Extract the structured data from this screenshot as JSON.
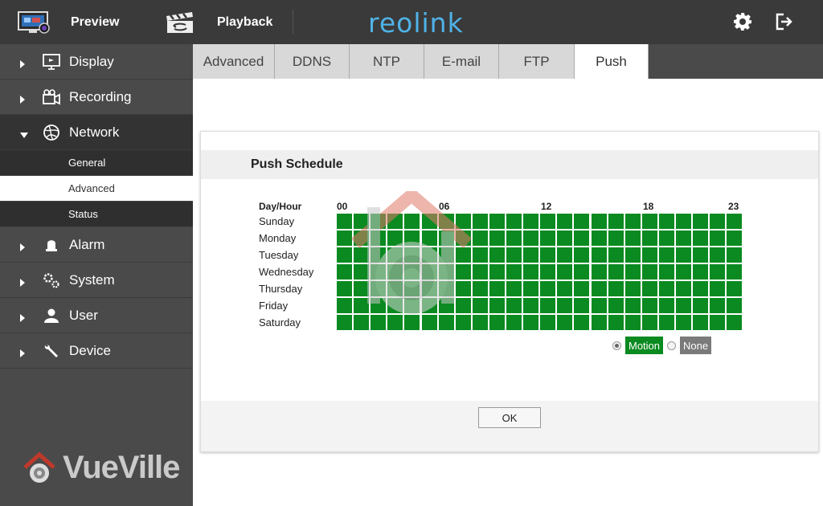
{
  "topbar": {
    "preview_label": "Preview",
    "playback_label": "Playback",
    "brand": "reolink"
  },
  "sidebar": {
    "items": [
      {
        "label": "Display",
        "icon": "monitor-icon"
      },
      {
        "label": "Recording",
        "icon": "camera-icon"
      },
      {
        "label": "Network",
        "icon": "globe-icon",
        "open": true
      },
      {
        "label": "Alarm",
        "icon": "alarm-icon"
      },
      {
        "label": "System",
        "icon": "gears-icon"
      },
      {
        "label": "User",
        "icon": "user-icon"
      },
      {
        "label": "Device",
        "icon": "wrench-icon"
      }
    ],
    "network_sub": [
      "General",
      "Advanced",
      "Status"
    ],
    "active_sub": "Advanced"
  },
  "watermark": "VueVille",
  "tabs": [
    "Advanced",
    "DDNS",
    "NTP",
    "E-mail",
    "FTP",
    "Push"
  ],
  "active_tab": "Push",
  "schedule": {
    "title": "Push Schedule",
    "day_hour_label": "Day/Hour",
    "hour_labels": [
      "00",
      "06",
      "12",
      "18",
      "23"
    ],
    "days": [
      "Sunday",
      "Monday",
      "Tuesday",
      "Wednesday",
      "Thursday",
      "Friday",
      "Saturday"
    ],
    "hours_count": 24,
    "cell_color_motion": "#0a8a20",
    "legend": {
      "motion_label": "Motion",
      "none_label": "None",
      "motion_color": "#0a8a20",
      "none_color": "#7a7a7a",
      "selected": "Motion"
    },
    "ok_label": "OK"
  }
}
